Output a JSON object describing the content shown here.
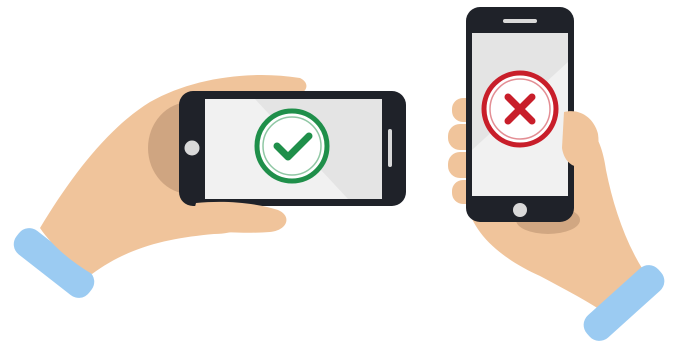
{
  "illustration": {
    "left_example": {
      "orientation": "landscape",
      "status_icon": "checkmark-icon",
      "status": "correct"
    },
    "right_example": {
      "orientation": "portrait",
      "status_icon": "cross-icon",
      "status": "incorrect"
    }
  },
  "colors": {
    "skin": "#f0c49b",
    "skin_shadow": "#c9a07c",
    "sleeve": "#9bcbf2",
    "phone_body": "#1f2229",
    "screen": "#f1f1f1",
    "screen_shade": "#e4e4e4",
    "check_green": "#1f8f4a",
    "cross_red": "#c81e2a",
    "home_button": "#d9d9d9"
  }
}
